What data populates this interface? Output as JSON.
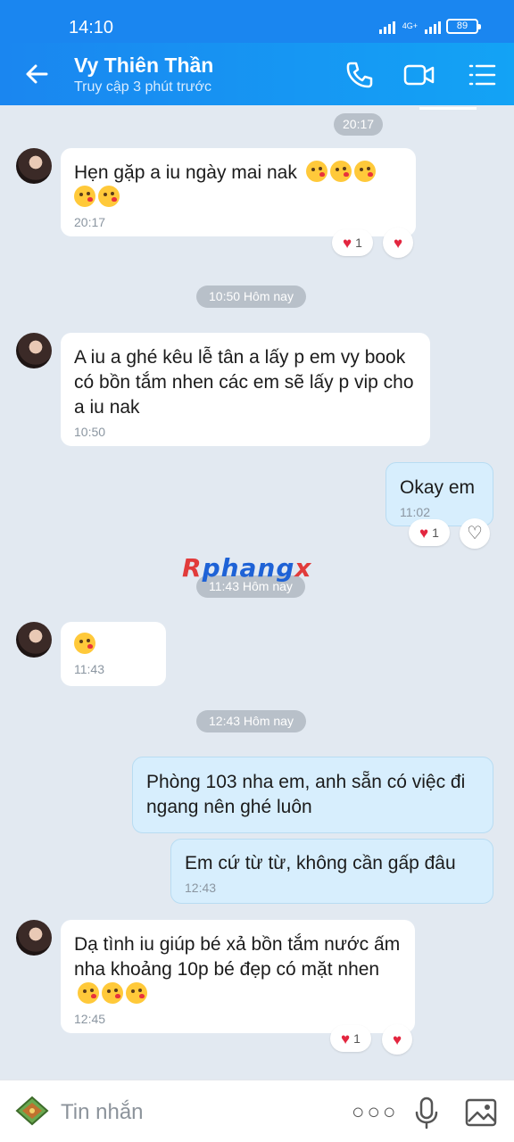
{
  "status": {
    "time": "14:10",
    "network": "4G+",
    "battery": "89"
  },
  "header": {
    "title": "Vy Thiên Thần",
    "subtitle": "Truy cập 3 phút trước"
  },
  "chat": {
    "top_time": "20:17",
    "messages": [
      {
        "sender": "contact",
        "text": "Hẹn gặp a iu ngày mai nak",
        "emoji_count": 5,
        "time": "20:17",
        "reactions": [
          "1"
        ]
      },
      {
        "divider": "10:50 Hôm nay"
      },
      {
        "sender": "contact",
        "text": "A iu a ghé kêu lễ tân a lấy p em vy book có bồn tắm nhen các em sẽ lấy p vip cho a iu nak",
        "time": "10:50"
      },
      {
        "sender": "me",
        "text": "Okay em",
        "time": "11:02",
        "reactions": [
          "1"
        ]
      },
      {
        "divider": "11:43 Hôm nay"
      },
      {
        "sender": "contact",
        "emoji_count": 1,
        "time": "11:43"
      },
      {
        "divider": "12:43 Hôm nay"
      },
      {
        "sender": "me",
        "text": "Phòng 103 nha em, anh sẵn có việc đi ngang nên ghé luôn"
      },
      {
        "sender": "me",
        "text": "Em cứ từ từ, không cần gấp đâu",
        "time": "12:43"
      },
      {
        "sender": "contact",
        "text": "Dạ tình iu giúp bé xả bồn tắm nước ấm nha khoảng 10p bé đẹp có mặt nhen",
        "emoji_count": 3,
        "time": "12:45",
        "reactions": [
          "1"
        ]
      }
    ],
    "watermark": "Rphangx"
  },
  "input": {
    "placeholder": "Tin nhắn"
  },
  "icons": {
    "back": "arrow-left-icon",
    "call": "phone-icon",
    "video": "video-camera-icon",
    "menu": "list-menu-icon",
    "sticker": "sticker-icon",
    "more": "more-dots-icon",
    "mic": "microphone-icon",
    "image": "image-icon"
  },
  "colors": {
    "header": "#1a86f0",
    "chat_bg": "#e2e9f1",
    "my_bubble": "#d7eefd",
    "heart": "#e3263f"
  }
}
